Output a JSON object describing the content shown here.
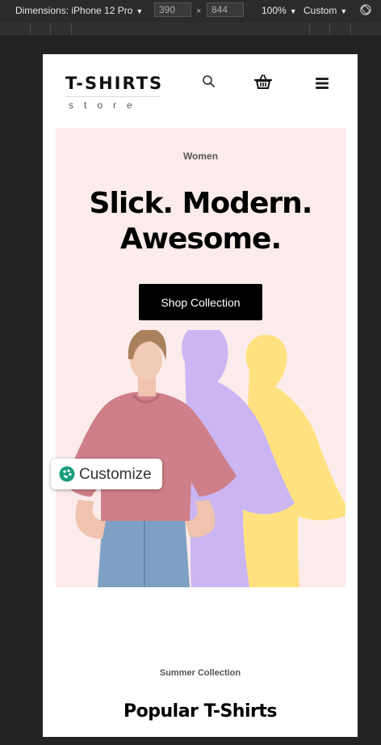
{
  "devtools": {
    "device_label": "Dimensions: iPhone 12 Pro",
    "width_value": "390",
    "height_value": "844",
    "times": "×",
    "zoom_label": "100%",
    "throttle_label": "Custom"
  },
  "site": {
    "logo_main": "T-SHIRTS",
    "logo_sub": "store"
  },
  "hero": {
    "eyebrow": "Women",
    "headline": "Slick. Modern. Awesome.",
    "cta_label": "Shop Collection",
    "bg_color": "#fbebea",
    "shadow_purple": "#cbb6f3",
    "shadow_yellow": "#ffe27f",
    "shirt_color": "#cf7f89"
  },
  "customize": {
    "label": "Customize"
  },
  "section": {
    "eyebrow": "Summer Collection",
    "title": "Popular T-Shirts"
  }
}
